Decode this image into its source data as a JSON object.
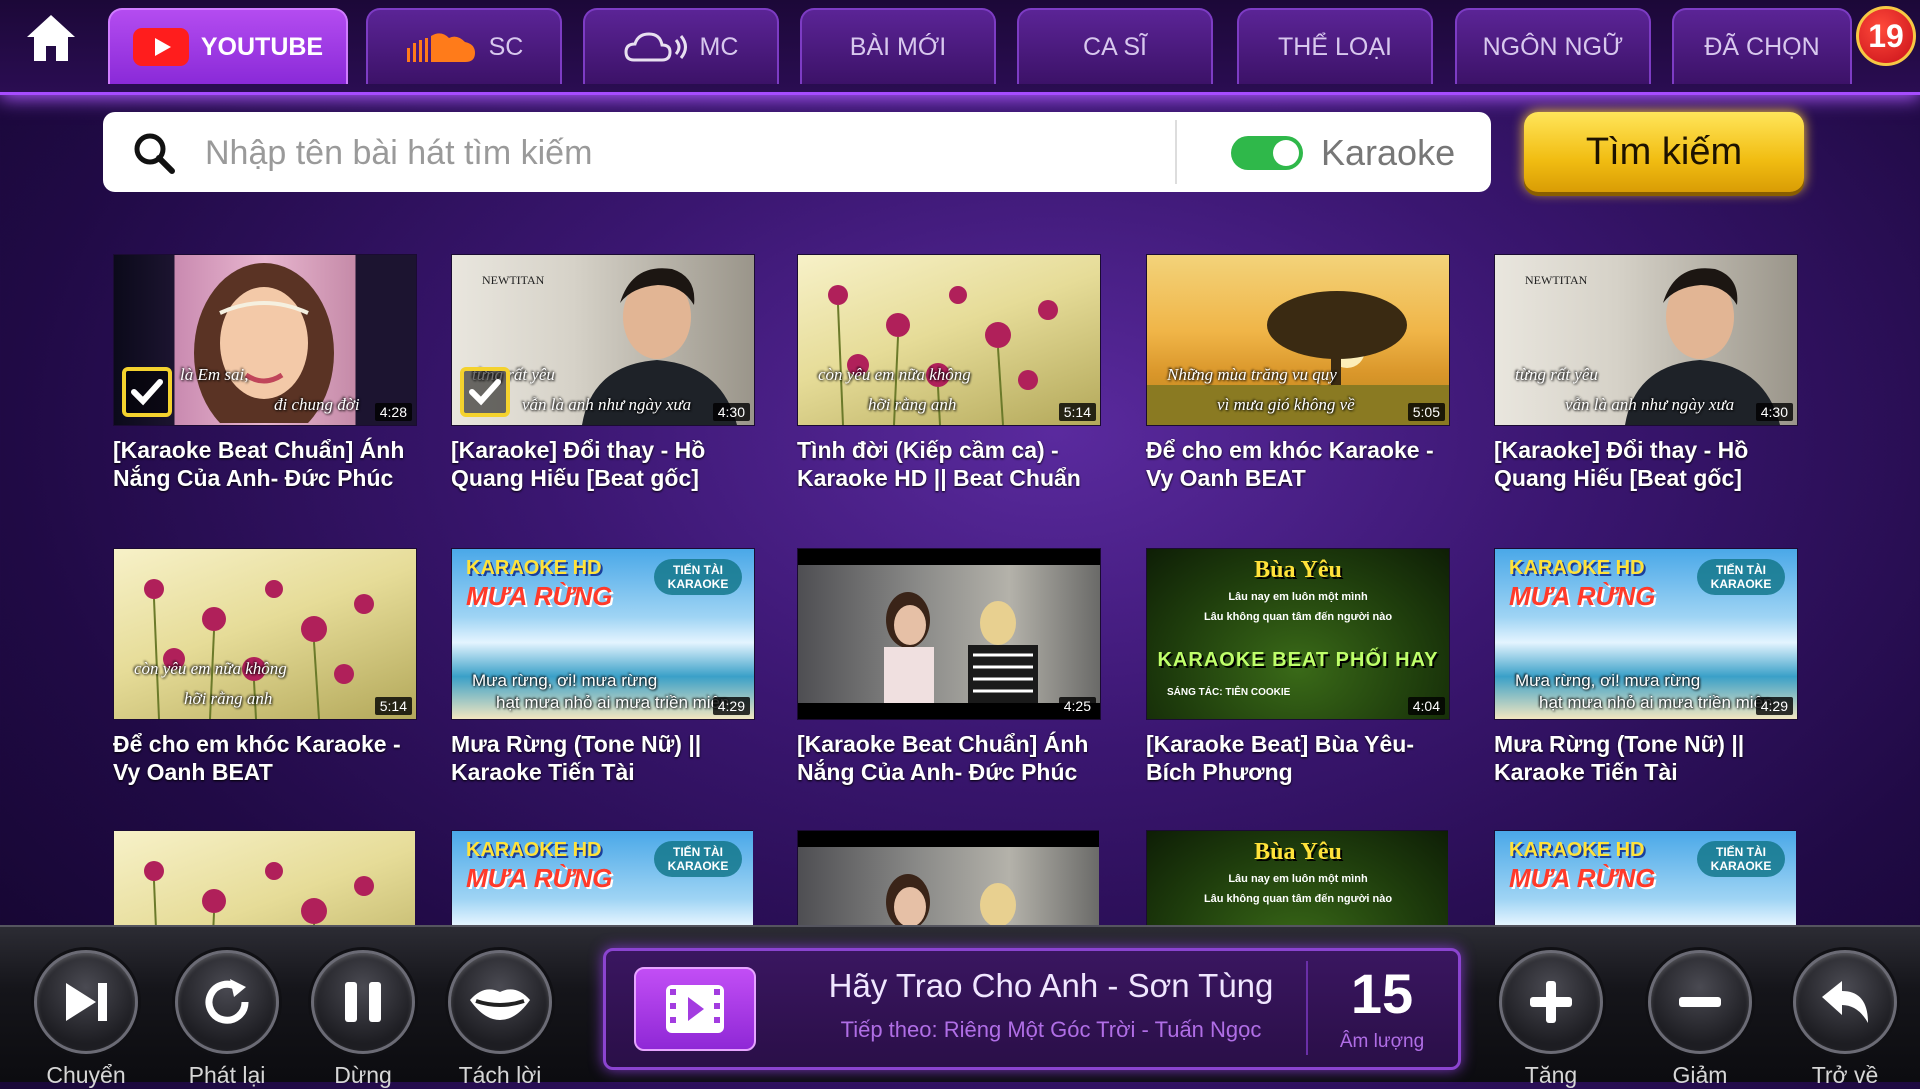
{
  "tabs": [
    {
      "label": "YOUTUBE",
      "icon": "youtube-icon",
      "active": true
    },
    {
      "label": "SC",
      "icon": "soundcloud-icon",
      "active": false
    },
    {
      "label": "MC",
      "icon": "mixcloud-icon",
      "active": false
    },
    {
      "label": "BÀI MỚI",
      "active": false
    },
    {
      "label": "CA SĨ",
      "active": false
    },
    {
      "label": "THỂ LOẠI",
      "active": false
    },
    {
      "label": "NGÔN NGỮ",
      "active": false
    },
    {
      "label": "ĐÃ CHỌN",
      "active": false
    }
  ],
  "selected_count": "19",
  "search": {
    "placeholder": "Nhập tên bài hát tìm kiếm",
    "value": "",
    "toggle_label": "Karaoke",
    "toggle_on": true,
    "button_label": "Tìm kiếm"
  },
  "videos": [
    {
      "title": "[Karaoke Beat Chuẩn] Ánh Nắng Của Anh- Đức Phúc",
      "duration": "4:28",
      "selected": true,
      "thumb": {
        "line1": "là Em sai,",
        "line2": "đi chung đời"
      }
    },
    {
      "title": "[Karaoke] Đổi thay - Hồ Quang Hiếu [Beat gốc]",
      "duration": "4:30",
      "selected": true,
      "thumb": {
        "brand": "NEWTITAN",
        "line1": "từng rất yêu",
        "line2": "vẫn là anh như ngày xưa"
      }
    },
    {
      "title": "Tình đời (Kiếp cầm ca) - Karaoke HD || Beat Chuẩn",
      "duration": "5:14",
      "selected": false,
      "thumb": {
        "line1": "còn yêu em nữa không",
        "line2": "hỡi rằng anh"
      }
    },
    {
      "title": "Để cho em khóc Karaoke - Vy Oanh BEAT",
      "duration": "5:05",
      "selected": false,
      "thumb": {
        "line1": "Những mùa trăng vu quy",
        "line2": "vì mưa gió không về"
      }
    },
    {
      "title": "[Karaoke] Đổi thay - Hồ Quang Hiếu [Beat gốc]",
      "duration": "4:30",
      "selected": false,
      "thumb": {
        "brand": "NEWTITAN",
        "line1": "từng rất yêu",
        "line2": "vẫn là anh như ngày xưa"
      }
    },
    {
      "title": "Để cho em khóc Karaoke - Vy Oanh BEAT",
      "duration": "5:14",
      "selected": false,
      "thumb": {
        "line1": "còn yêu em nữa không",
        "line2": "hỡi rằng anh"
      }
    },
    {
      "title": "Mưa Rừng (Tone Nữ) || Karaoke Tiến Tài",
      "duration": "4:29",
      "selected": false,
      "thumb": {
        "kar": "KARAOKE HD",
        "song": "MƯA RỪNG",
        "tag": "TIẾN TÀI KARAOKE",
        "line1": "Mưa rừng, ơi! mưa rừng",
        "line2": "hạt mưa nhỏ ai mưa triền miên"
      }
    },
    {
      "title": "[Karaoke Beat Chuẩn] Ánh Nắng Của Anh- Đức Phúc",
      "duration": "4:25",
      "selected": false,
      "thumb": {}
    },
    {
      "title": "[Karaoke Beat] Bùa Yêu- Bích Phương",
      "duration": "4:04",
      "selected": false,
      "thumb": {
        "song": "Bùa Yêu",
        "sub1": "Lâu nay em luôn một mình",
        "sub2": "Lâu không quan tâm đến người nào",
        "beat": "KARAOKE BEAT PHỐI HAY",
        "credit": "SÁNG TÁC: TIÊN COOKIE"
      }
    },
    {
      "title": "Mưa Rừng (Tone Nữ) || Karaoke Tiến Tài",
      "duration": "4:29",
      "selected": false,
      "thumb": {
        "kar": "KARAOKE HD",
        "song": "MƯA RỪNG",
        "tag": "TIẾN TÀI KARAOKE",
        "line1": "Mưa rừng, ơi! mưa rừng",
        "line2": "hạt mưa nhỏ ai mưa triền miên"
      }
    }
  ],
  "partial_row": [
    {
      "kind": "flowers"
    },
    {
      "kind": "muarung",
      "kar": "KARAOKE HD",
      "song": "MƯA RỪNG",
      "tag": "TIẾN TÀI KARAOKE"
    },
    {
      "kind": "movie"
    },
    {
      "kind": "buayeu",
      "song": "Bùa Yêu",
      "sub1": "Lâu nay em luôn một mình",
      "sub2": "Lâu không quan tâm đến người nào"
    },
    {
      "kind": "muarung",
      "kar": "KARAOKE HD",
      "song": "MƯA RỪNG",
      "tag": "TIẾN TÀI KARAOKE"
    }
  ],
  "controls_left": [
    {
      "label": "Chuyển",
      "icon": "skip-next-icon"
    },
    {
      "label": "Phát lại",
      "icon": "replay-icon"
    },
    {
      "label": "Dừng",
      "icon": "pause-icon"
    },
    {
      "label": "Tách lời",
      "icon": "lips-icon"
    }
  ],
  "controls_right": [
    {
      "label": "Tăng",
      "icon": "plus-icon"
    },
    {
      "label": "Giảm",
      "icon": "minus-icon"
    },
    {
      "label": "Trở về",
      "icon": "back-arrow-icon"
    }
  ],
  "now_playing": {
    "title": "Hãy Trao Cho Anh - Sơn Tùng",
    "next": "Tiếp theo: Riêng Một Góc Trời - Tuấn Ngọc",
    "volume": "15",
    "volume_label": "Âm lượng"
  },
  "colors": {
    "accent": "#a64cff",
    "active_tab": "#b44cf0",
    "search_button": "#f1bd12",
    "toggle_on": "#2fb84a",
    "badge": "#c8101a"
  }
}
